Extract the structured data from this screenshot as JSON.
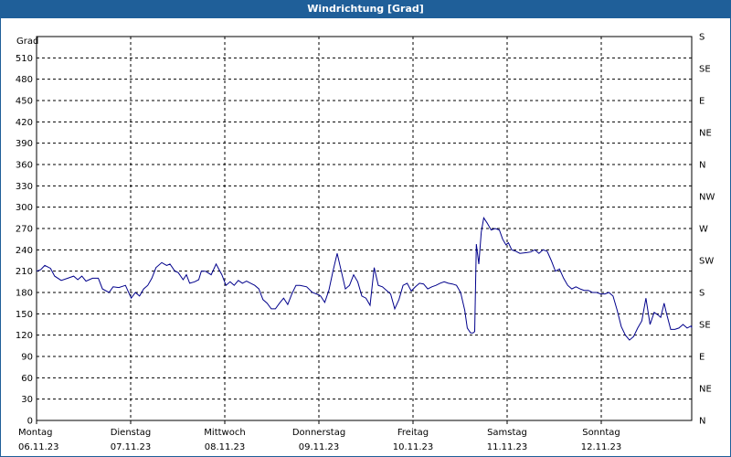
{
  "header": {
    "title": "Windrichtung [Grad]"
  },
  "chart_data": {
    "type": "line",
    "title": "Windrichtung [Grad]",
    "ylabel": "Grad",
    "ylim": [
      0,
      540
    ],
    "yticks": [
      0,
      30,
      60,
      90,
      120,
      150,
      180,
      210,
      240,
      270,
      300,
      330,
      360,
      390,
      420,
      450,
      480,
      510
    ],
    "right_axis_ticks": [
      {
        "value": 0,
        "label": "N"
      },
      {
        "value": 45,
        "label": "NE"
      },
      {
        "value": 90,
        "label": "E"
      },
      {
        "value": 135,
        "label": "SE"
      },
      {
        "value": 180,
        "label": "S"
      },
      {
        "value": 225,
        "label": "SW"
      },
      {
        "value": 270,
        "label": "W"
      },
      {
        "value": 315,
        "label": "NW"
      },
      {
        "value": 360,
        "label": "N"
      },
      {
        "value": 405,
        "label": "NE"
      },
      {
        "value": 450,
        "label": "E"
      },
      {
        "value": 495,
        "label": "SE"
      },
      {
        "value": 540,
        "label": "S"
      }
    ],
    "xlim": [
      0,
      7
    ],
    "x_unit": "days",
    "days": [
      {
        "x": 0,
        "day": "Montag",
        "date": "06.11.23"
      },
      {
        "x": 1,
        "day": "Dienstag",
        "date": "07.11.23"
      },
      {
        "x": 2,
        "day": "Mittwoch",
        "date": "08.11.23"
      },
      {
        "x": 3,
        "day": "Donnerstag",
        "date": "09.11.23"
      },
      {
        "x": 4,
        "day": "Freitag",
        "date": "10.11.23"
      },
      {
        "x": 5,
        "day": "Samstag",
        "date": "11.11.23"
      },
      {
        "x": 6,
        "day": "Sonntag",
        "date": "12.11.23"
      }
    ],
    "grid": true,
    "series": [
      {
        "color": "#00008b",
        "points": [
          [
            0.0,
            210
          ],
          [
            0.05,
            212
          ],
          [
            0.1,
            218
          ],
          [
            0.17,
            214
          ],
          [
            0.22,
            203
          ],
          [
            0.3,
            197
          ],
          [
            0.38,
            200
          ],
          [
            0.45,
            203
          ],
          [
            0.5,
            198
          ],
          [
            0.55,
            203
          ],
          [
            0.6,
            196
          ],
          [
            0.68,
            200
          ],
          [
            0.75,
            200
          ],
          [
            0.8,
            185
          ],
          [
            0.88,
            180
          ],
          [
            0.93,
            188
          ],
          [
            1.0,
            187
          ],
          [
            1.08,
            190
          ],
          [
            1.15,
            172
          ],
          [
            1.2,
            180
          ],
          [
            1.25,
            175
          ],
          [
            1.3,
            185
          ],
          [
            1.35,
            190
          ],
          [
            1.4,
            200
          ],
          [
            1.45,
            215
          ],
          [
            1.52,
            222
          ],
          [
            1.58,
            218
          ],
          [
            1.62,
            220
          ],
          [
            1.68,
            210
          ],
          [
            1.72,
            208
          ],
          [
            1.78,
            198
          ],
          [
            1.82,
            205
          ],
          [
            1.86,
            193
          ],
          [
            1.92,
            195
          ],
          [
            1.97,
            198
          ],
          [
            2.0,
            210
          ],
          [
            2.05,
            210
          ],
          [
            2.12,
            205
          ],
          [
            2.18,
            220
          ],
          [
            2.25,
            205
          ],
          [
            2.3,
            190
          ],
          [
            2.35,
            195
          ],
          [
            2.4,
            190
          ],
          [
            2.45,
            197
          ],
          [
            2.5,
            193
          ],
          [
            2.55,
            196
          ],
          [
            2.6,
            193
          ],
          [
            2.65,
            190
          ],
          [
            2.7,
            185
          ],
          [
            2.75,
            170
          ],
          [
            2.8,
            165
          ],
          [
            2.85,
            157
          ],
          [
            2.9,
            157
          ],
          [
            2.95,
            165
          ],
          [
            3.0,
            172
          ],
          [
            3.05,
            163
          ],
          [
            3.1,
            178
          ],
          [
            3.15,
            190
          ],
          [
            3.2,
            190
          ],
          [
            3.28,
            188
          ],
          [
            3.35,
            180
          ],
          [
            3.4,
            178
          ],
          [
            3.45,
            175
          ],
          [
            3.5,
            166
          ],
          [
            3.55,
            183
          ],
          [
            3.6,
            210
          ],
          [
            3.65,
            235
          ],
          [
            3.7,
            210
          ],
          [
            3.75,
            185
          ],
          [
            3.8,
            190
          ],
          [
            3.85,
            205
          ],
          [
            3.9,
            195
          ],
          [
            3.95,
            175
          ],
          [
            4.0,
            172
          ],
          [
            4.05,
            162
          ],
          [
            4.1,
            215
          ],
          [
            4.15,
            190
          ],
          [
            4.2,
            188
          ],
          [
            4.25,
            183
          ],
          [
            4.3,
            178
          ],
          [
            4.35,
            157
          ],
          [
            4.4,
            170
          ],
          [
            4.45,
            190
          ],
          [
            4.5,
            193
          ],
          [
            4.55,
            182
          ],
          [
            4.6,
            188
          ],
          [
            4.65,
            193
          ],
          [
            4.7,
            192
          ],
          [
            4.75,
            185
          ],
          [
            4.8,
            188
          ],
          [
            4.85,
            190
          ],
          [
            4.9,
            193
          ],
          [
            4.95,
            195
          ],
          [
            5.0,
            193
          ],
          [
            5.05,
            192
          ],
          [
            5.1,
            190
          ],
          [
            5.15,
            180
          ],
          [
            5.2,
            155
          ],
          [
            5.23,
            130
          ],
          [
            5.27,
            123
          ],
          [
            5.3,
            123
          ],
          [
            5.32,
            125
          ],
          [
            5.34,
            248
          ],
          [
            5.37,
            220
          ],
          [
            5.4,
            265
          ],
          [
            5.43,
            285
          ],
          [
            5.47,
            278
          ],
          [
            5.52,
            268
          ],
          [
            5.57,
            270
          ],
          [
            5.62,
            268
          ],
          [
            5.66,
            255
          ],
          [
            5.7,
            247
          ],
          [
            5.73,
            250
          ],
          [
            5.77,
            240
          ],
          [
            5.82,
            238
          ],
          [
            5.87,
            235
          ],
          [
            5.95,
            236
          ],
          [
            6.0,
            237
          ],
          [
            6.05,
            240
          ],
          [
            6.1,
            235
          ],
          [
            6.15,
            240
          ],
          [
            6.2,
            238
          ],
          [
            6.25,
            225
          ],
          [
            6.3,
            210
          ],
          [
            6.35,
            213
          ],
          [
            6.4,
            200
          ],
          [
            6.45,
            190
          ],
          [
            6.5,
            185
          ],
          [
            6.55,
            188
          ],
          [
            6.6,
            185
          ],
          [
            6.65,
            183
          ],
          [
            6.7,
            183
          ],
          [
            6.75,
            180
          ],
          [
            6.8,
            180
          ],
          [
            6.85,
            178
          ],
          [
            6.9,
            178
          ],
          [
            6.95,
            180
          ],
          [
            7.0,
            175
          ],
          [
            7.05,
            155
          ],
          [
            7.1,
            132
          ],
          [
            7.15,
            120
          ],
          [
            7.2,
            113
          ],
          [
            7.25,
            118
          ],
          [
            7.3,
            130
          ],
          [
            7.35,
            140
          ],
          [
            7.4,
            172
          ],
          [
            7.45,
            135
          ],
          [
            7.5,
            152
          ],
          [
            7.55,
            148
          ],
          [
            7.58,
            145
          ],
          [
            7.62,
            165
          ],
          [
            7.65,
            150
          ],
          [
            7.7,
            128
          ],
          [
            7.75,
            128
          ],
          [
            7.8,
            130
          ],
          [
            7.85,
            135
          ],
          [
            7.9,
            130
          ],
          [
            7.95,
            133
          ],
          [
            8.0,
            130
          ]
        ]
      }
    ]
  }
}
